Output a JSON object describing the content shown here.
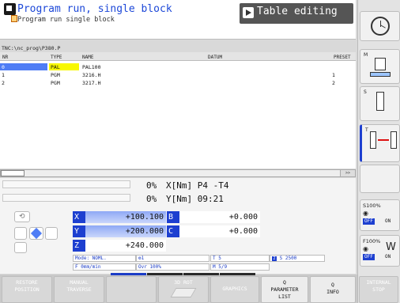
{
  "header": {
    "mode_title": "Program run, single block",
    "mode_subtitle": "Program run single block",
    "tab_label": "Table editing"
  },
  "table": {
    "path": "TNC:\\nc_prog\\P380.P",
    "columns": [
      "NR",
      "TYPE",
      "NAME",
      "DATUM",
      "PRESET"
    ],
    "rows": [
      {
        "nr": "0",
        "type": "PAL",
        "name": "PAL100",
        "preset": ""
      },
      {
        "nr": "1",
        "type": "PGM",
        "name": "3216.H",
        "preset": "1"
      },
      {
        "nr": "2",
        "type": "PGM",
        "name": "3217.H",
        "preset": "2"
      }
    ],
    "scroll_button": ">>"
  },
  "status": {
    "line1_pct": "0%",
    "line1_text": "X[Nm] P4  -T4",
    "line2_pct": "0%",
    "line2_text": "Y[Nm] 09:21"
  },
  "axes": {
    "x": {
      "label": "X",
      "value": "+100.100"
    },
    "b": {
      "label": "B",
      "value": "+0.000"
    },
    "y": {
      "label": "Y",
      "value": "+200.000"
    },
    "c": {
      "label": "C",
      "value": "+0.000"
    },
    "z": {
      "label": "Z",
      "value": "+240.000"
    }
  },
  "info": {
    "mode": "Mode: NOML.",
    "feed": "F 0mm/min",
    "ovr": "Ovr 100%",
    "tool_num": "1",
    "tool": "T 5",
    "m": "M 5/9",
    "spindle": "S 2500"
  },
  "sidebar": {
    "m_label": "M",
    "s_label": "S",
    "t_label": "T",
    "s_override": "S100%",
    "f_override": "F100%",
    "off1": "OFF",
    "on1": "ON",
    "off2": "OFF",
    "on2": "ON"
  },
  "softkeys": {
    "restore": [
      "RESTORE",
      "POSITION"
    ],
    "manual": [
      "MANUAL",
      "TRAVERSE"
    ],
    "rot3d": "3D ROT",
    "graphics": "GRAPHICS",
    "param": [
      "Q",
      "PARAMETER",
      "LIST"
    ],
    "info": [
      "Q",
      "INFO"
    ],
    "internal": [
      "INTERNAL",
      "STOP"
    ]
  },
  "colors": {
    "accent": "#1d3fd0",
    "title": "#1d48d8",
    "highlight_row": "#4f7df5",
    "type_highlight": "#f8f800"
  }
}
